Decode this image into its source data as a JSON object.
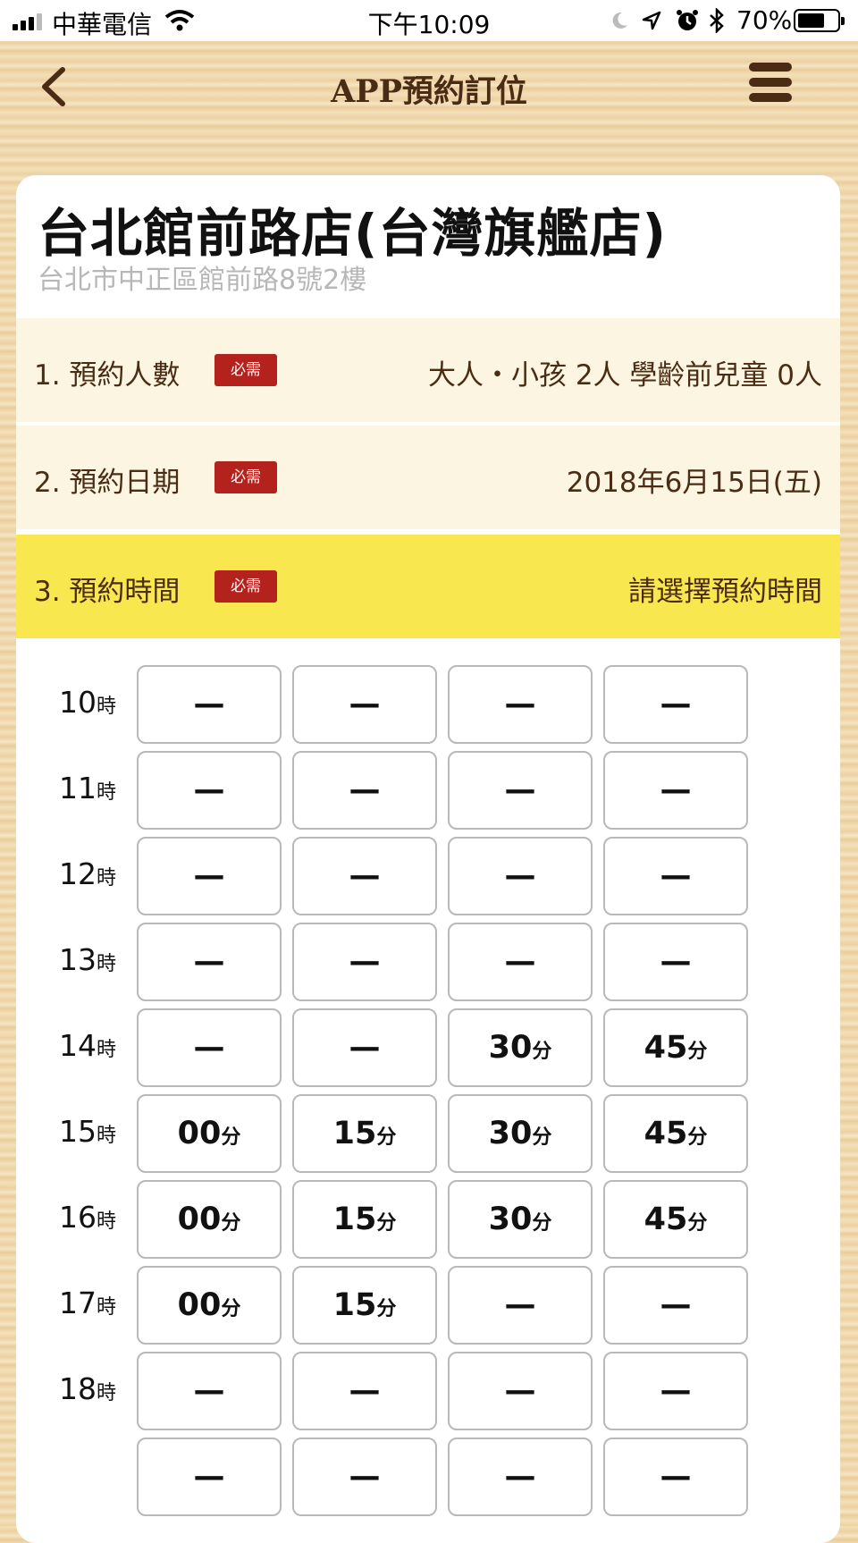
{
  "status_bar": {
    "carrier": "中華電信",
    "time": "下午10:09",
    "battery": "70%",
    "battery_level": 0.7,
    "icons": [
      "signal-icon",
      "wifi-icon",
      "moon-icon",
      "location-icon",
      "alarm-icon",
      "bluetooth-icon",
      "battery-icon"
    ]
  },
  "nav": {
    "title": "APP預約訂位",
    "back_icon": "chevron-left-icon",
    "menu_icon": "hamburger-menu-icon"
  },
  "store": {
    "name": "台北館前路店(台灣旗艦店)",
    "address": "台北市中正區館前路8號2樓"
  },
  "form": {
    "required_badge": "必需",
    "party_size": {
      "label": "1. 預約人數",
      "value": "大人・小孩 2人 學齡前兒童 0人"
    },
    "date": {
      "label": "2. 預約日期",
      "value": "2018年6月15日(五)"
    },
    "time": {
      "label": "3. 預約時間",
      "value": "請選擇預約時間"
    }
  },
  "colors": {
    "accent_brown": "#4a2c14",
    "required_red": "#b3221d",
    "highlight_yellow": "#f8e74f",
    "row_bg": "#fcf5e1"
  },
  "time_grid": {
    "hour_suffix": "時",
    "minute_suffix": "分",
    "unavailable": "—",
    "hours": [
      {
        "hour": "10",
        "slots": [
          "",
          "",
          "",
          ""
        ]
      },
      {
        "hour": "11",
        "slots": [
          "",
          "",
          "",
          ""
        ]
      },
      {
        "hour": "12",
        "slots": [
          "",
          "",
          "",
          ""
        ]
      },
      {
        "hour": "13",
        "slots": [
          "",
          "",
          "",
          ""
        ]
      },
      {
        "hour": "14",
        "slots": [
          "",
          "",
          "30",
          "45"
        ]
      },
      {
        "hour": "15",
        "slots": [
          "00",
          "15",
          "30",
          "45"
        ]
      },
      {
        "hour": "16",
        "slots": [
          "00",
          "15",
          "30",
          "45"
        ]
      },
      {
        "hour": "17",
        "slots": [
          "00",
          "15",
          "",
          ""
        ]
      },
      {
        "hour": "18",
        "slots": [
          "",
          "",
          "",
          ""
        ]
      },
      {
        "hour": "",
        "slots": [
          "",
          "",
          "",
          ""
        ]
      }
    ]
  }
}
